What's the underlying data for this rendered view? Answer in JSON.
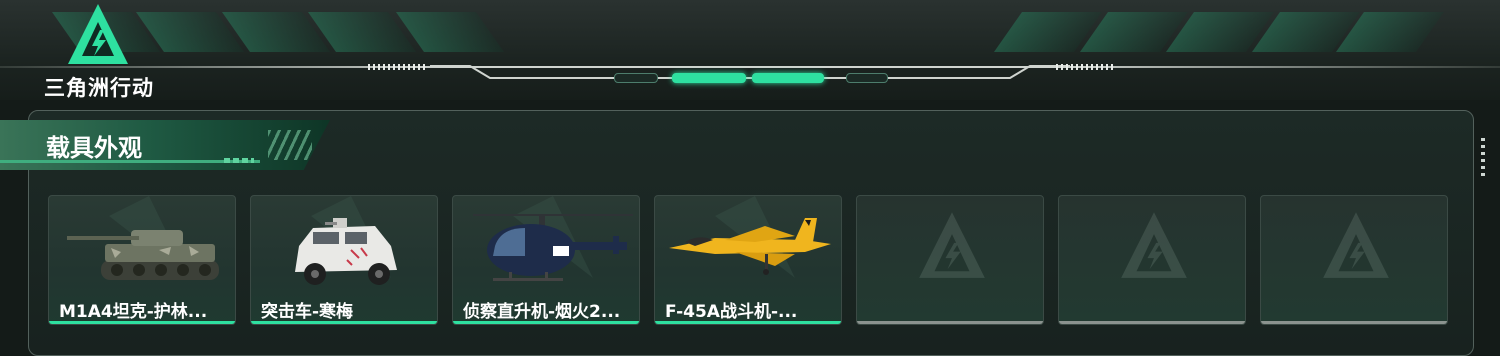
{
  "brand": {
    "logo_text": "三角洲行动",
    "accent": "#2ee0a0",
    "icon": "delta-triangle-icon"
  },
  "section": {
    "title": "载具外观"
  },
  "cards": [
    {
      "name": "M1A4坦克-护林...",
      "icon": "tank-icon",
      "state": "owned"
    },
    {
      "name": "突击车-寒梅",
      "icon": "armored-car-icon",
      "state": "owned"
    },
    {
      "name": "侦察直升机-烟火2...",
      "icon": "helicopter-icon",
      "state": "owned"
    },
    {
      "name": "F-45A战斗机-...",
      "icon": "fighter-jet-icon",
      "state": "owned"
    },
    {
      "name": "",
      "icon": "delta-triangle-icon",
      "state": "empty"
    },
    {
      "name": "",
      "icon": "delta-triangle-icon",
      "state": "empty"
    },
    {
      "name": "",
      "icon": "delta-triangle-icon",
      "state": "empty"
    }
  ]
}
